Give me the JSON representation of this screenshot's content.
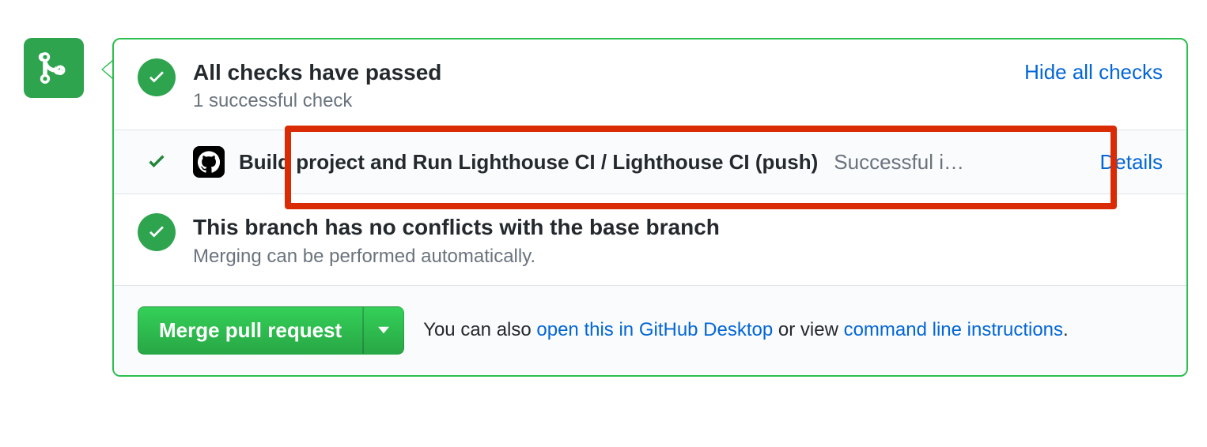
{
  "checks": {
    "title": "All checks have passed",
    "subtitle": "1 successful check",
    "toggle_link": "Hide all checks",
    "items": [
      {
        "name": "Build project and Run Lighthouse CI / Lighthouse CI (push)",
        "status": "Successful i…",
        "details_label": "Details"
      }
    ]
  },
  "conflicts": {
    "title": "This branch has no conflicts with the base branch",
    "subtitle": "Merging can be performed automatically."
  },
  "merge": {
    "button_label": "Merge pull request",
    "hint_prefix": "You can also ",
    "desktop_link": "open this in GitHub Desktop",
    "hint_middle": " or view ",
    "cli_link": "command line instructions",
    "hint_suffix": "."
  }
}
